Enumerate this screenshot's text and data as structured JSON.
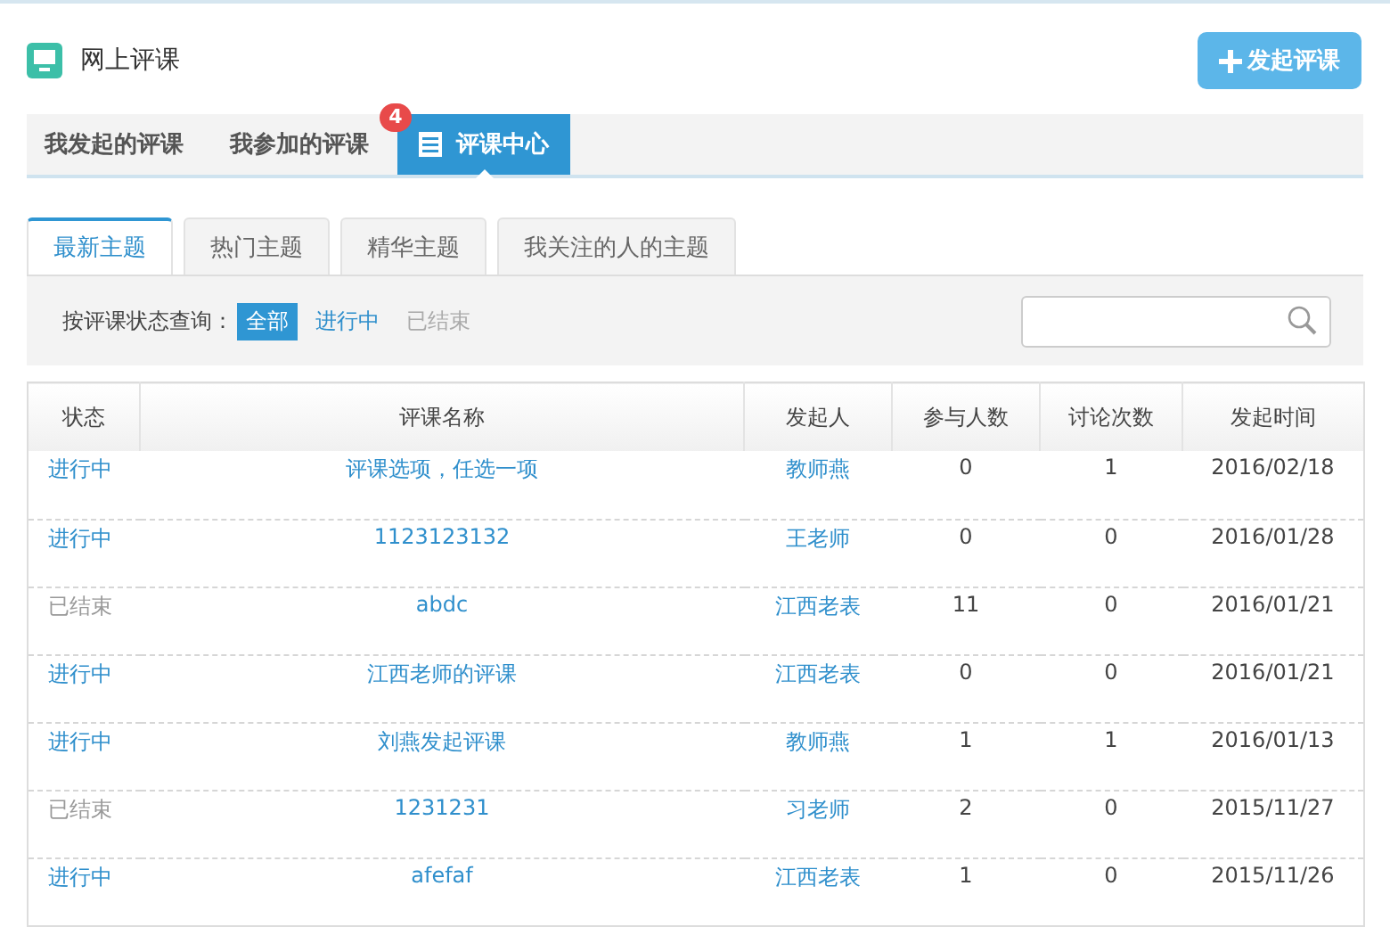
{
  "header": {
    "title": "网上评课",
    "action_button": "发起评课"
  },
  "main_tabs": [
    {
      "label": "我发起的评课",
      "selected": false
    },
    {
      "label": "我参加的评课",
      "selected": false,
      "badge": "4"
    },
    {
      "label": "评课中心",
      "selected": true
    }
  ],
  "sub_tabs": [
    {
      "label": "最新主题",
      "selected": true
    },
    {
      "label": "热门主题",
      "selected": false
    },
    {
      "label": "精华主题",
      "selected": false
    },
    {
      "label": "我关注的人的主题",
      "selected": false
    }
  ],
  "filter": {
    "label": "按评课状态查询：",
    "options": [
      {
        "label": "全部",
        "selected": true
      },
      {
        "label": "进行中",
        "selected": false,
        "disabled": false
      },
      {
        "label": "已结束",
        "selected": false,
        "disabled": true
      }
    ]
  },
  "table": {
    "columns": [
      "状态",
      "评课名称",
      "发起人",
      "参与人数",
      "讨论次数",
      "发起时间"
    ],
    "rows": [
      {
        "status": "进行中",
        "ended": false,
        "name": "评课选项，任选一项",
        "initiator": "教师燕",
        "participants": "0",
        "discussions": "1",
        "time": "2016/02/18"
      },
      {
        "status": "进行中",
        "ended": false,
        "name": "1123123132",
        "initiator": "王老师",
        "participants": "0",
        "discussions": "0",
        "time": "2016/01/28"
      },
      {
        "status": "已结束",
        "ended": true,
        "name": "abdc",
        "initiator": "江西老表",
        "participants": "11",
        "discussions": "0",
        "time": "2016/01/21"
      },
      {
        "status": "进行中",
        "ended": false,
        "name": "江西老师的评课",
        "initiator": "江西老表",
        "participants": "0",
        "discussions": "0",
        "time": "2016/01/21"
      },
      {
        "status": "进行中",
        "ended": false,
        "name": "刘燕发起评课",
        "initiator": "教师燕",
        "participants": "1",
        "discussions": "1",
        "time": "2016/01/13"
      },
      {
        "status": "已结束",
        "ended": true,
        "name": "1231231",
        "initiator": "习老师",
        "participants": "2",
        "discussions": "0",
        "time": "2015/11/27"
      },
      {
        "status": "进行中",
        "ended": false,
        "name": "afefaf",
        "initiator": "江西老表",
        "participants": "1",
        "discussions": "0",
        "time": "2015/11/26"
      }
    ]
  }
}
